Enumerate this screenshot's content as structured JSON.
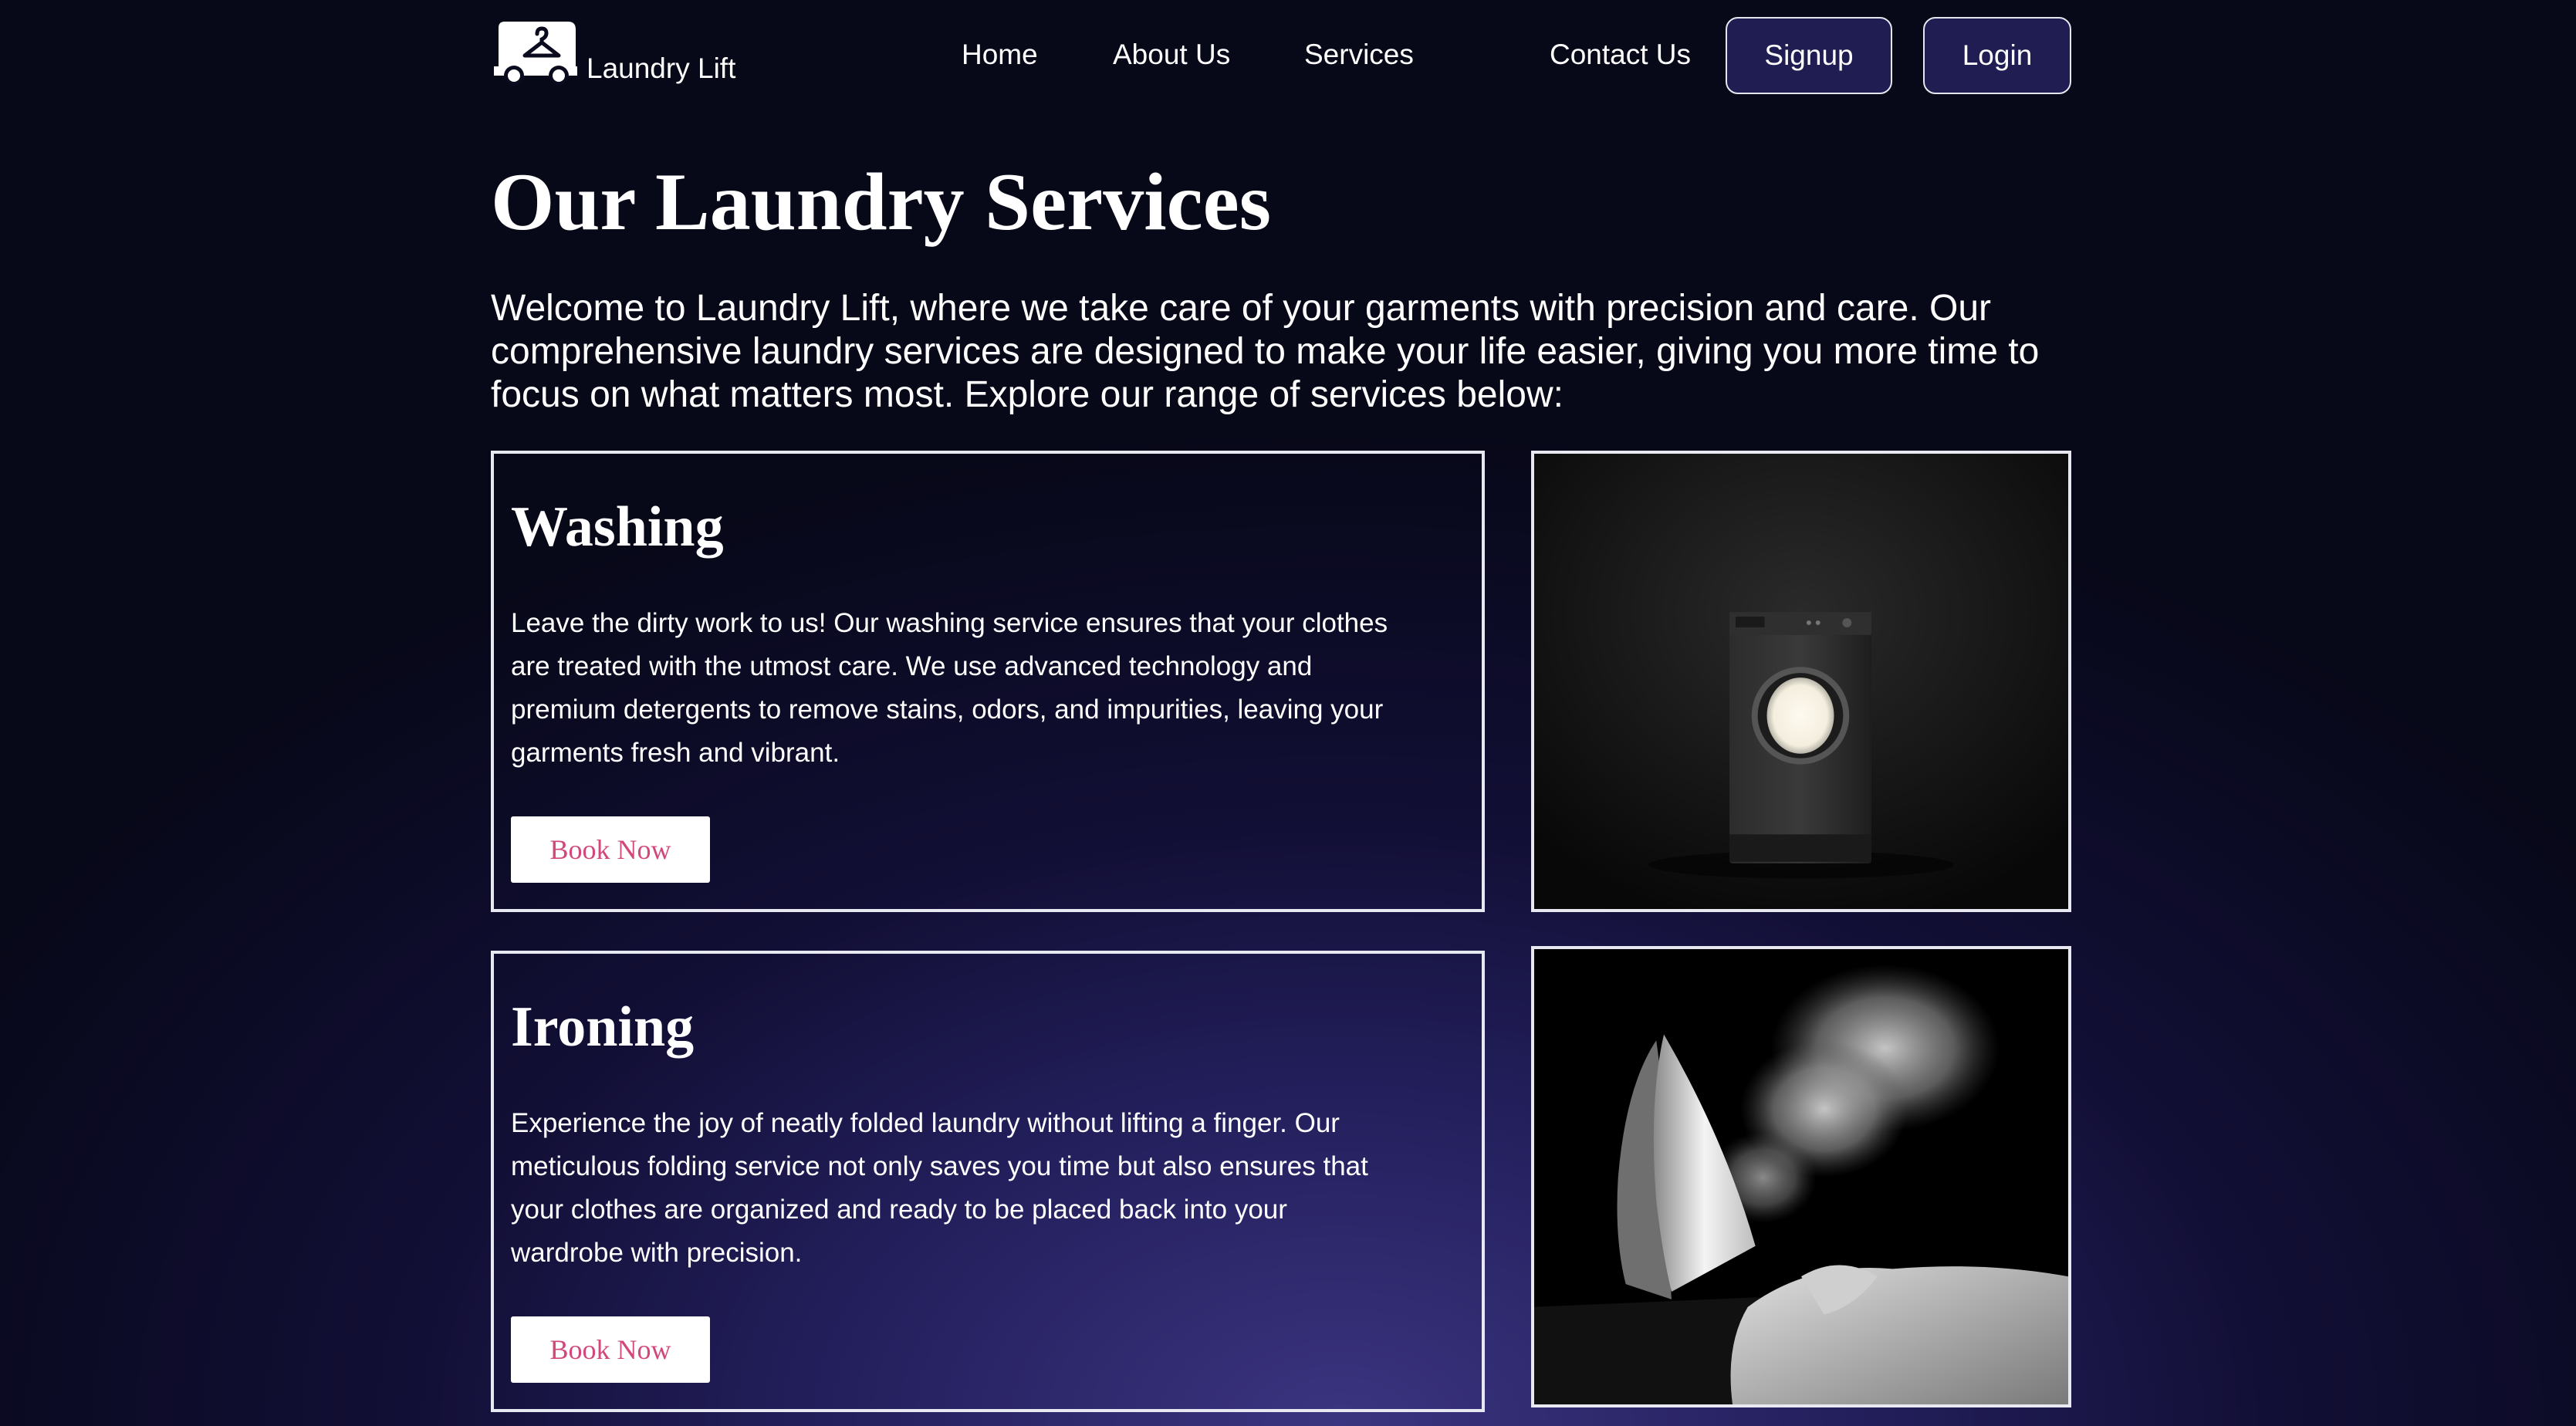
{
  "brand": {
    "name": "Laundry Lift",
    "logo_icon": "delivery-van-hanger-icon"
  },
  "nav": {
    "links": [
      "Home",
      "About Us",
      "Services",
      "Contact Us"
    ],
    "signup_label": "Signup",
    "login_label": "Login"
  },
  "main": {
    "title": "Our Laundry Services",
    "intro": "Welcome to Laundry Lift, where we take care of your garments with precision and care. Our comprehensive laundry services are designed to make your life easier, giving you more time to focus on what matters most. Explore our range of services below:",
    "services": [
      {
        "title": "Washing",
        "description": "Leave the dirty work to us! Our washing service ensures that your clothes are treated with the utmost care. We use advanced technology and premium detergents to remove stains, odors, and impurities, leaving your garments fresh and vibrant.",
        "button_label": "Book Now",
        "image": "washing-machine-photo"
      },
      {
        "title": "Ironing",
        "description": "Experience the joy of neatly folded laundry without lifting a finger. Our meticulous folding service not only saves you time but also ensures that your clothes are organized and ready to be placed back into your wardrobe with precision.",
        "button_label": "Book Now",
        "image": "steam-iron-photo"
      }
    ]
  },
  "colors": {
    "background_dark": "#070818",
    "background_glow": "#3b3480",
    "button_bg": "#201d52",
    "book_now_text": "#d2487a",
    "border": "#e8e8f0"
  }
}
